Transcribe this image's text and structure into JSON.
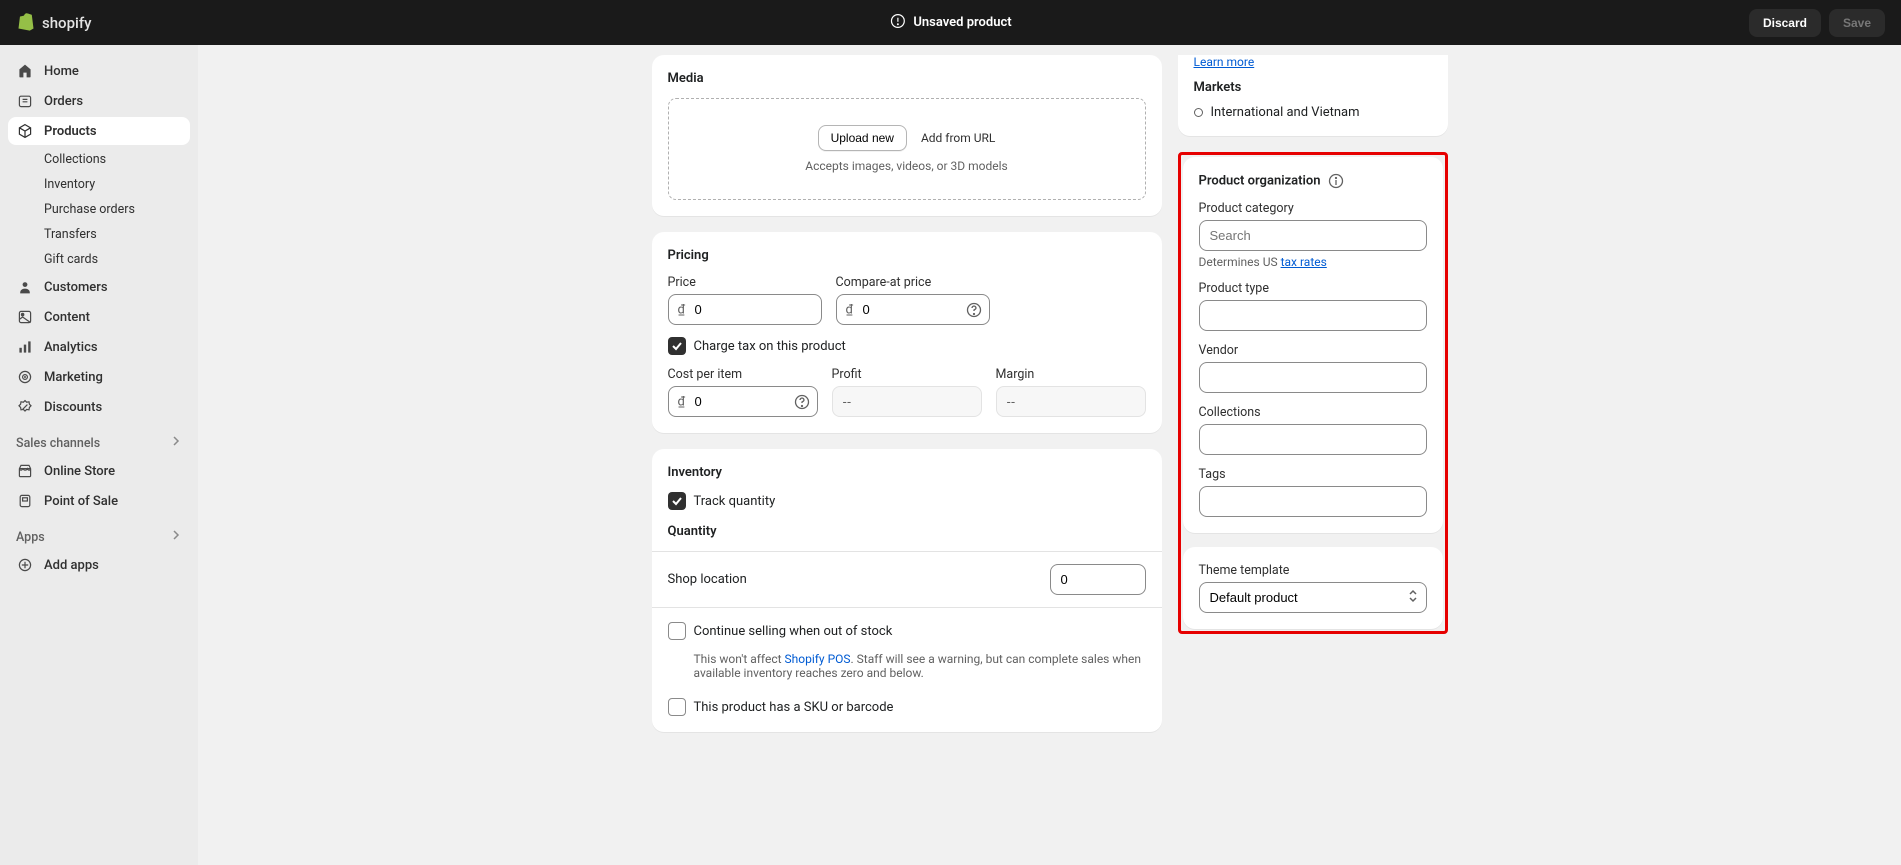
{
  "topbar": {
    "brand": "shopify",
    "status": "Unsaved product",
    "discard": "Discard",
    "save": "Save"
  },
  "sidebar": {
    "items": [
      {
        "label": "Home"
      },
      {
        "label": "Orders"
      },
      {
        "label": "Products"
      },
      {
        "label": "Customers"
      },
      {
        "label": "Content"
      },
      {
        "label": "Analytics"
      },
      {
        "label": "Marketing"
      },
      {
        "label": "Discounts"
      }
    ],
    "products_sub": [
      {
        "label": "Collections"
      },
      {
        "label": "Inventory"
      },
      {
        "label": "Purchase orders"
      },
      {
        "label": "Transfers"
      },
      {
        "label": "Gift cards"
      }
    ],
    "sales_channels_header": "Sales channels",
    "channels": [
      {
        "label": "Online Store"
      },
      {
        "label": "Point of Sale"
      }
    ],
    "apps_header": "Apps",
    "add_apps": "Add apps"
  },
  "media": {
    "title": "Media",
    "upload": "Upload new",
    "add_url": "Add from URL",
    "hint": "Accepts images, videos, or 3D models"
  },
  "pricing": {
    "title": "Pricing",
    "price_label": "Price",
    "price_currency": "₫",
    "price_value": "0",
    "compare_label": "Compare-at price",
    "compare_value": "0",
    "charge_tax": "Charge tax on this product",
    "cost_label": "Cost per item",
    "cost_value": "0",
    "profit_label": "Profit",
    "profit_value": "--",
    "margin_label": "Margin",
    "margin_value": "--"
  },
  "inventory": {
    "title": "Inventory",
    "track": "Track quantity",
    "quantity_header": "Quantity",
    "location": "Shop location",
    "location_qty": "0",
    "continue_selling": "Continue selling when out of stock",
    "continue_note_pre": "This won't affect ",
    "continue_link": "Shopify POS",
    "continue_note_post": ". Staff will see a warning, but can complete sales when available inventory reaches zero and below.",
    "sku": "This product has a SKU or barcode"
  },
  "upper_right": {
    "learn_more": "Learn more",
    "markets_header": "Markets",
    "market": "International and Vietnam"
  },
  "org": {
    "title": "Product organization",
    "category_label": "Product category",
    "category_placeholder": "Search",
    "category_hint_pre": "Determines US ",
    "category_link": "tax rates",
    "type_label": "Product type",
    "vendor_label": "Vendor",
    "collections_label": "Collections",
    "tags_label": "Tags"
  },
  "template": {
    "label": "Theme template",
    "value": "Default product"
  }
}
